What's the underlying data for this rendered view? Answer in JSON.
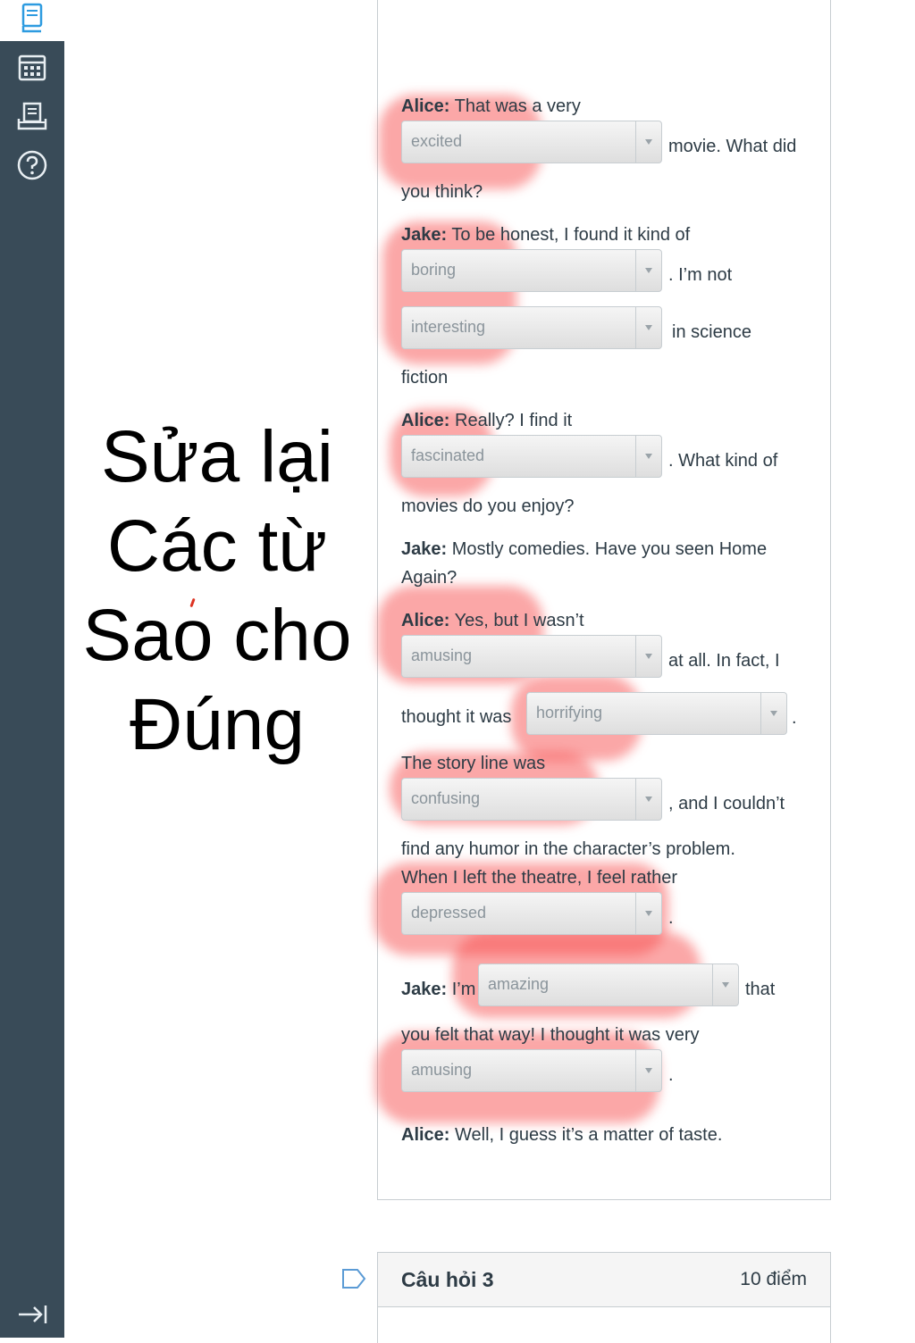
{
  "nav": {
    "icons": [
      "courses-icon",
      "calendar-icon",
      "inbox-icon",
      "help-icon",
      "collapse-nav-icon"
    ]
  },
  "overlay": {
    "lines": [
      "Sửa lại",
      "Các từ",
      "Sao cho",
      "Đúng"
    ]
  },
  "dialogue": {
    "l1_speaker": "Alice:",
    "l1_text": " That was a very",
    "dd1": "excited",
    "l1_after": "movie. What did",
    "l1_cont": "you think?",
    "l2_speaker": "Jake:",
    "l2_text": " To be honest, I found it kind of",
    "dd2": "boring",
    "l2_after": ". I’m not",
    "dd3": "interesting",
    "l2_after2": "in science",
    "l2_cont": "fiction",
    "l3_speaker": "Alice:",
    "l3_text": " Really? I find it",
    "dd4": "fascinated",
    "l3_after": ". What kind of",
    "l3_cont": "movies do you enjoy?",
    "l4_speaker": "Jake:",
    "l4_text": " Mostly comedies. Have you seen Home",
    "l4_cont": "Again?",
    "l5_speaker": "Alice:",
    "l5_text": " Yes, but I wasn’t",
    "dd5": "amusing",
    "l5_after": "at all. In fact, I",
    "l5_before6": "thought it was",
    "dd6": "horrifying",
    "l5_after6": ".",
    "l6_text": "The story line was",
    "dd7": "confusing",
    "l6_after": ", and I couldn’t",
    "l6_cont": "find any humor in the character’s problem.",
    "l7_text": "When I left the theatre, I feel rather",
    "dd8": "depressed",
    "l7_after": ".",
    "l8_speaker": "Jake:",
    "l8_text": " I’m",
    "dd9": "amazing",
    "l8_after": "that",
    "l8_cont": "you felt that way! I thought it was very",
    "dd10": "amusing",
    "l8_after2": ".",
    "l9_speaker": "Alice:",
    "l9_text": " Well, I guess it’s a matter of taste."
  },
  "question3": {
    "title": "Câu hỏi 3",
    "points": "10 điểm"
  }
}
